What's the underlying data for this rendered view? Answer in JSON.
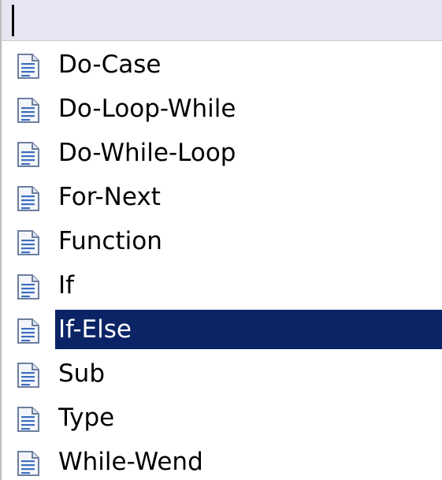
{
  "search": {
    "value": ""
  },
  "snippets": {
    "items": [
      {
        "label": "Do-Case",
        "icon": "snippet-document-icon",
        "selected": false
      },
      {
        "label": "Do-Loop-While",
        "icon": "snippet-document-icon",
        "selected": false
      },
      {
        "label": "Do-While-Loop",
        "icon": "snippet-document-icon",
        "selected": false
      },
      {
        "label": "For-Next",
        "icon": "snippet-document-icon",
        "selected": false
      },
      {
        "label": "Function",
        "icon": "snippet-document-icon",
        "selected": false
      },
      {
        "label": "If",
        "icon": "snippet-document-icon",
        "selected": false
      },
      {
        "label": "If-Else",
        "icon": "snippet-document-icon",
        "selected": true
      },
      {
        "label": "Sub",
        "icon": "snippet-document-icon",
        "selected": false
      },
      {
        "label": "Type",
        "icon": "snippet-document-icon",
        "selected": false
      },
      {
        "label": "While-Wend",
        "icon": "snippet-document-icon",
        "selected": false
      }
    ]
  },
  "colors": {
    "selection_background": "#0a2466",
    "selection_text": "#ffffff",
    "search_background": "#e6e6f3"
  }
}
